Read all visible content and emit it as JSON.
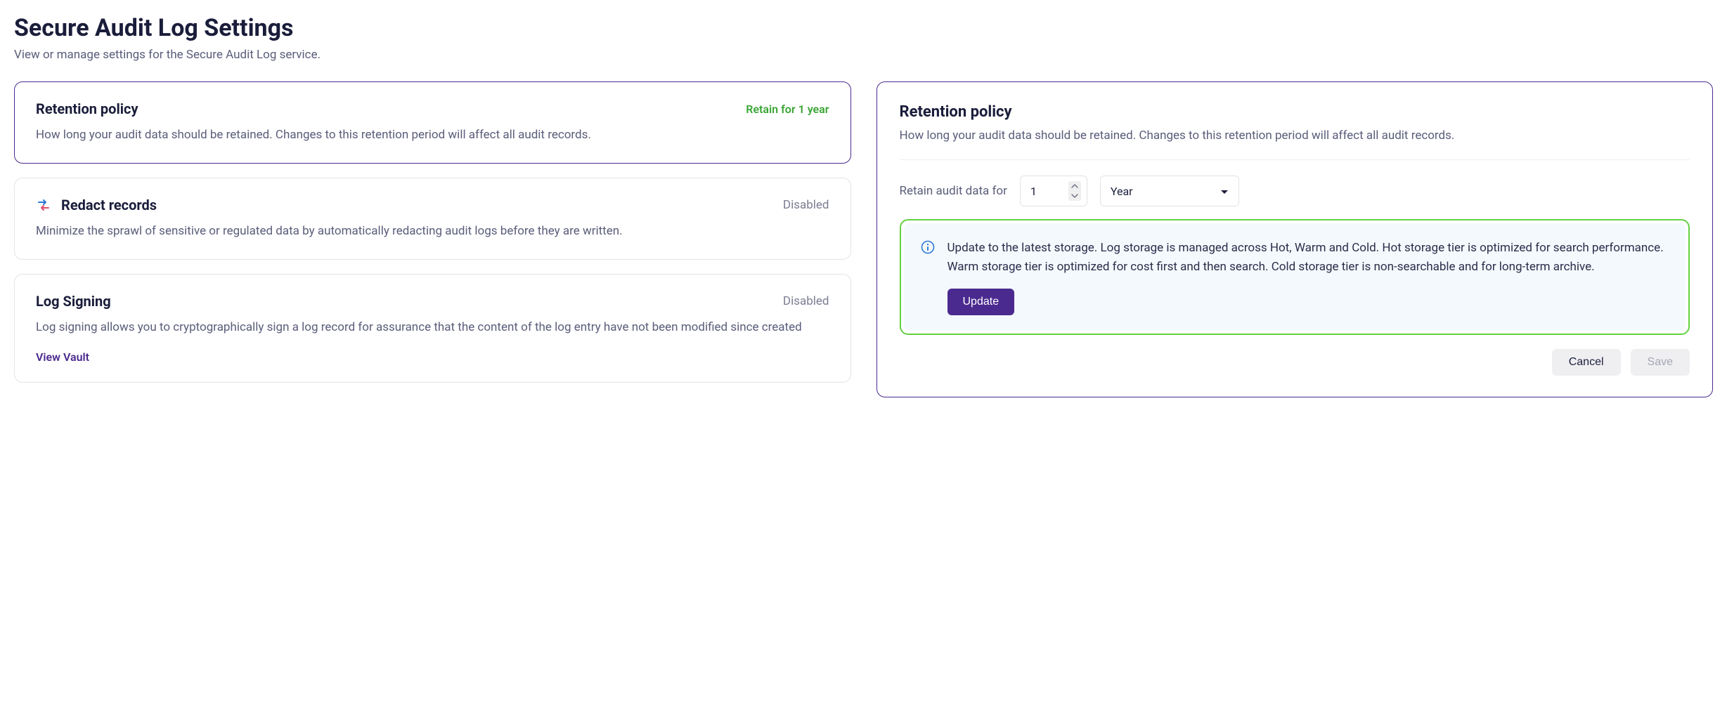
{
  "header": {
    "title": "Secure Audit Log Settings",
    "subtitle": "View or manage settings for the Secure Audit Log service."
  },
  "cards": {
    "retention": {
      "title": "Retention policy",
      "status": "Retain for 1 year",
      "desc": "How long your audit data should be retained. Changes to this retention period will affect all audit records."
    },
    "redact": {
      "title": "Redact records",
      "status": "Disabled",
      "desc": "Minimize the sprawl of sensitive or regulated data by automatically redacting audit logs before they are written."
    },
    "signing": {
      "title": "Log Signing",
      "status": "Disabled",
      "desc": "Log signing allows you to cryptographically sign a log record for assurance that the content of the log entry have not been modified since created",
      "link": "View Vault"
    }
  },
  "detail": {
    "title": "Retention policy",
    "desc": "How long your audit data should be retained. Changes to this retention period will affect all audit records.",
    "form": {
      "label": "Retain audit data for",
      "value": "1",
      "unit": "Year"
    },
    "notice": {
      "text": "Update to the latest storage. Log storage is managed across Hot, Warm and Cold. Hot storage tier is optimized for search performance. Warm storage tier is optimized for cost first and then search. Cold storage tier is non-searchable and for long-term archive.",
      "button": "Update"
    },
    "actions": {
      "cancel": "Cancel",
      "save": "Save"
    }
  }
}
